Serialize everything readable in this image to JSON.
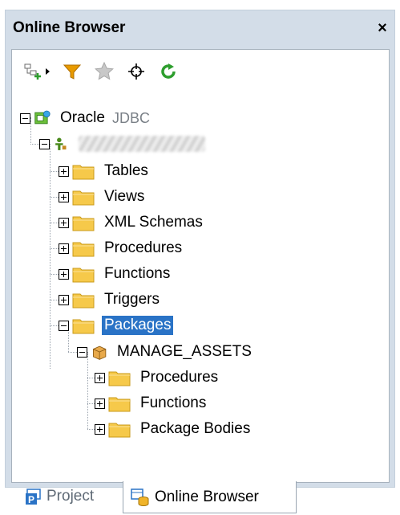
{
  "panel": {
    "title": "Online Browser",
    "close_label": "×"
  },
  "toolbar": {
    "buttons": [
      "add-connection-icon",
      "dropdown-arrow-icon",
      "filter-icon",
      "favorite-star-icon",
      "locate-icon",
      "refresh-icon"
    ]
  },
  "tree": {
    "root": {
      "label": "Oracle",
      "suffix": "JDBC"
    },
    "schema": {
      "label": ""
    },
    "folders": [
      "Tables",
      "Views",
      "XML Schemas",
      "Procedures",
      "Functions",
      "Triggers",
      "Packages"
    ],
    "package": {
      "label": "MANAGE_ASSETS"
    },
    "package_children": [
      "Procedures",
      "Functions",
      "Package Bodies"
    ]
  },
  "tabs": [
    {
      "label": "Project",
      "icon": "project-icon"
    },
    {
      "label": "Online Browser",
      "icon": "online-browser-icon"
    }
  ],
  "colors": {
    "panel_bg": "#d3dde8",
    "selection": "#2a73c6",
    "folder": "#f6c94a",
    "refresh": "#2e9e2e",
    "filter": "#e89a00"
  }
}
